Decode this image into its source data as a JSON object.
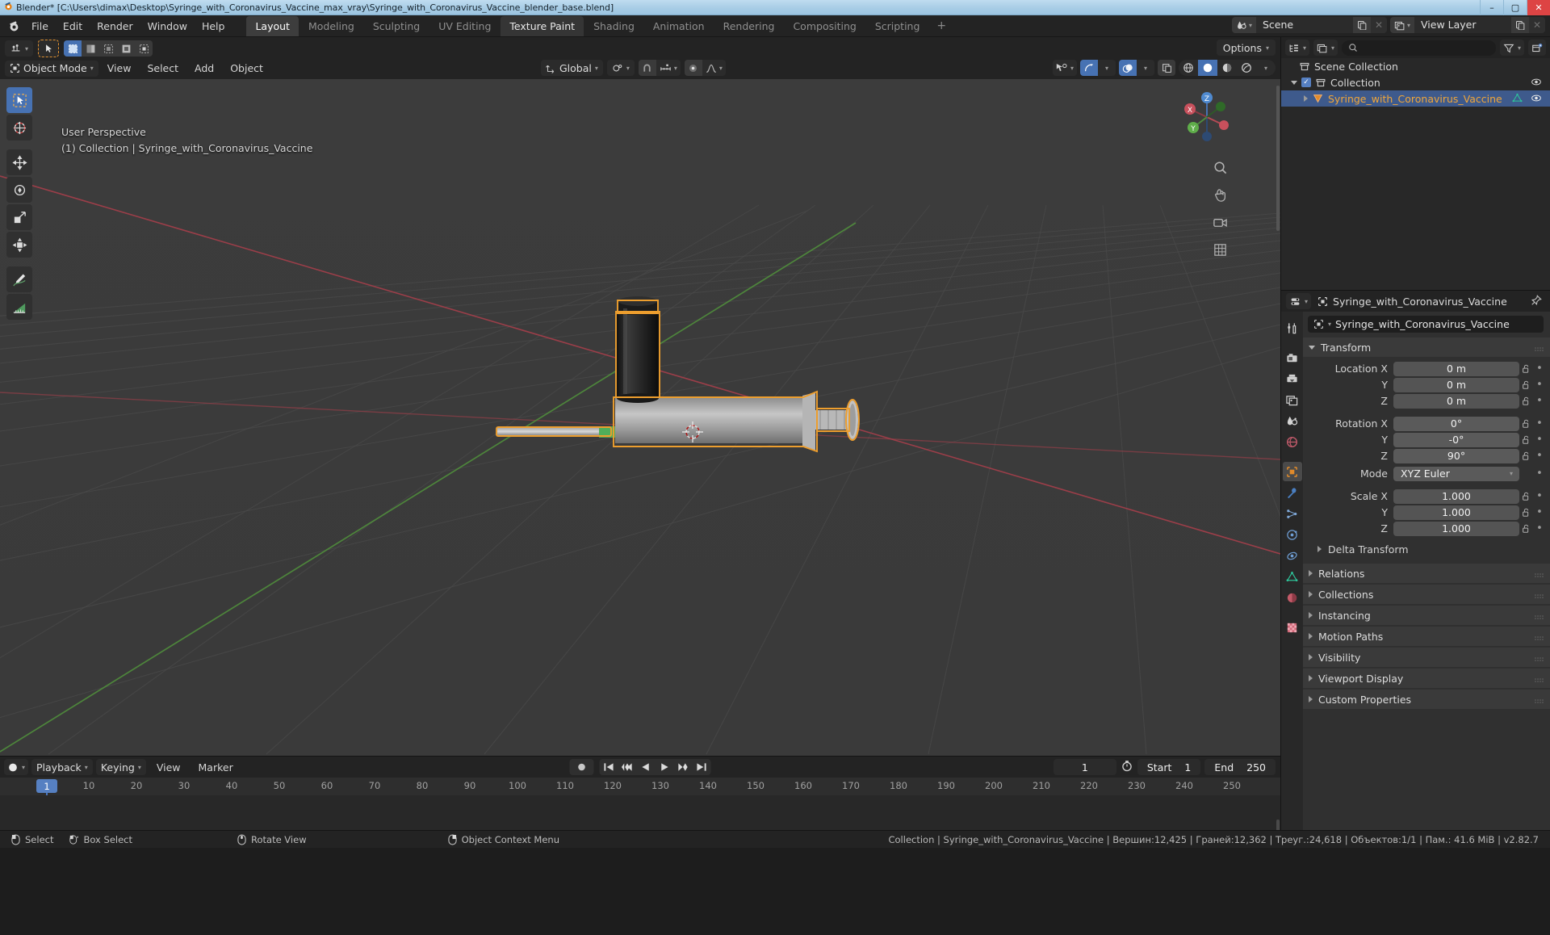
{
  "window": {
    "title": "Blender* [C:\\Users\\dimax\\Desktop\\Syringe_with_Coronavirus_Vaccine_max_vray\\Syringe_with_Coronavirus_Vaccine_blender_base.blend]",
    "minimize": "–",
    "maximize": "▢",
    "close": "✕"
  },
  "topbar": {
    "menus": [
      "File",
      "Edit",
      "Render",
      "Window",
      "Help"
    ],
    "workspaces": [
      {
        "label": "Layout",
        "state": "active"
      },
      {
        "label": "Modeling",
        "state": "normal"
      },
      {
        "label": "Sculpting",
        "state": "normal"
      },
      {
        "label": "UV Editing",
        "state": "normal"
      },
      {
        "label": "Texture Paint",
        "state": "highlight"
      },
      {
        "label": "Shading",
        "state": "normal"
      },
      {
        "label": "Animation",
        "state": "normal"
      },
      {
        "label": "Rendering",
        "state": "normal"
      },
      {
        "label": "Compositing",
        "state": "normal"
      },
      {
        "label": "Scripting",
        "state": "normal"
      }
    ],
    "add_workspace": "+",
    "scene_name": "Scene",
    "view_layer_name": "View Layer"
  },
  "viewport": {
    "mode": "Object Mode",
    "menus": [
      "View",
      "Select",
      "Add",
      "Object"
    ],
    "transform_orientation": "Global",
    "options_label": "Options",
    "overlay_line1": "User Perspective",
    "overlay_line2": "(1) Collection | Syringe_with_Coronavirus_Vaccine",
    "gizmo_axes": {
      "x": "X",
      "y": "Y",
      "z": "Z"
    }
  },
  "outliner": {
    "search_placeholder": "",
    "rows": [
      {
        "label": "Scene Collection",
        "indent": 0,
        "type": "scene-collection",
        "selected": false
      },
      {
        "label": "Collection",
        "indent": 1,
        "type": "collection",
        "selected": false
      },
      {
        "label": "Syringe_with_Coronavirus_Vaccine",
        "indent": 2,
        "type": "mesh-object",
        "selected": true
      }
    ]
  },
  "properties": {
    "breadcrumb_object": "Syringe_with_Coronavirus_Vaccine",
    "object_name_field": "Syringe_with_Coronavirus_Vaccine",
    "transform_title": "Transform",
    "fields": [
      {
        "label": "Location X",
        "value": "0 m"
      },
      {
        "label": "Y",
        "value": "0 m"
      },
      {
        "label": "Z",
        "value": "0 m"
      },
      {
        "label": "Rotation X",
        "value": "0°"
      },
      {
        "label": "Y",
        "value": "-0°"
      },
      {
        "label": "Z",
        "value": "90°"
      },
      {
        "label": "Mode",
        "value": "XYZ Euler"
      },
      {
        "label": "Scale X",
        "value": "1.000"
      },
      {
        "label": "Y",
        "value": "1.000"
      },
      {
        "label": "Z",
        "value": "1.000"
      }
    ],
    "delta_transform": "Delta Transform",
    "panels": [
      "Relations",
      "Collections",
      "Instancing",
      "Motion Paths",
      "Visibility",
      "Viewport Display",
      "Custom Properties"
    ]
  },
  "timeline": {
    "menus": [
      "Playback",
      "Keying",
      "View",
      "Marker"
    ],
    "current_frame": "1",
    "start_label": "Start",
    "start_value": "1",
    "end_label": "End",
    "end_value": "250",
    "ticks": [
      "10",
      "20",
      "30",
      "40",
      "50",
      "60",
      "70",
      "80",
      "90",
      "100",
      "110",
      "120",
      "130",
      "140",
      "150",
      "160",
      "170",
      "180",
      "190",
      "200",
      "210",
      "220",
      "230",
      "240",
      "250"
    ],
    "playhead_label": "1"
  },
  "statusbar": {
    "hints": [
      {
        "icon": "mouse-left",
        "label": "Select"
      },
      {
        "icon": "mouse-left-drag",
        "label": "Box Select"
      },
      {
        "icon": "mouse-middle",
        "label": "Rotate View"
      },
      {
        "icon": "mouse-right",
        "label": "Object Context Menu"
      }
    ],
    "stats": "Collection | Syringe_with_Coronavirus_Vaccine | Вершин:12,425 | Граней:12,362 | Треуг.:24,618 | Объектов:1/1 | Пам.: 41.6 MiB | v2.82.7"
  },
  "colors": {
    "accent_blue": "#4772b3",
    "selected_orange": "#ed9e2e",
    "header_bg": "#232323",
    "viewport_bg": "#393939",
    "panel_bg": "#303030"
  }
}
